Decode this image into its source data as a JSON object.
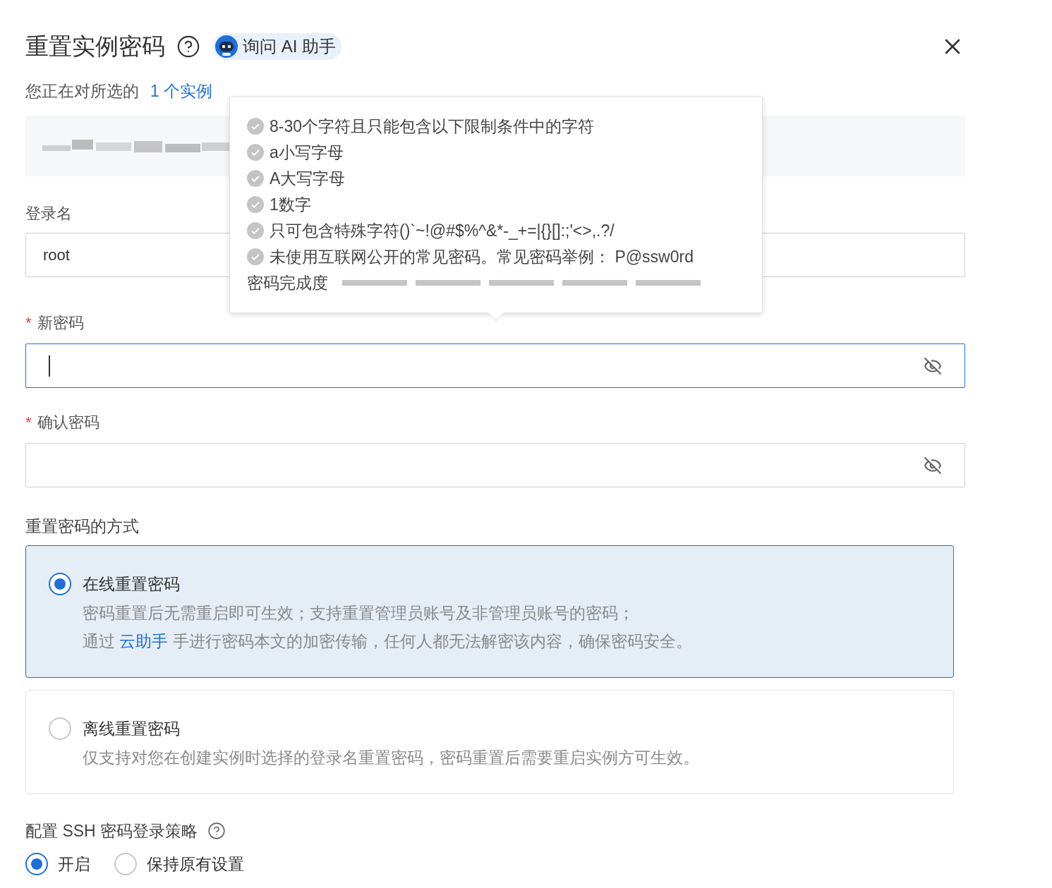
{
  "dialog": {
    "title": "重置实例密码",
    "ai_button": "询问 AI 助手"
  },
  "intro": {
    "text": "您正在对所选的",
    "link": "1 个实例"
  },
  "login_name": {
    "label": "登录名",
    "value": "root"
  },
  "new_password": {
    "label": "新密码",
    "required_mark": "*",
    "focused": true
  },
  "confirm_password": {
    "label": "确认密码",
    "required_mark": "*",
    "focused": false
  },
  "password_tooltip": {
    "rules": [
      {
        "text": "8-30个字符且只能包含以下限制条件中的字符",
        "met": false
      },
      {
        "text": "a小写字母",
        "met": false
      },
      {
        "text": "A大写字母",
        "met": false
      },
      {
        "text": "1数字",
        "met": false
      },
      {
        "text": "只可包含特殊字符()`~!@#$%^&*-_+=|{}[]:;'<>,.?/",
        "met": false
      },
      {
        "text": "未使用互联网公开的常见密码。常见密码举例： P@ssw0rd",
        "met": false
      }
    ],
    "strength": {
      "label": "密码完成度",
      "segments": [
        {
          "filled": false
        },
        {
          "filled": false
        },
        {
          "filled": false
        },
        {
          "filled": false
        },
        {
          "filled": false
        }
      ]
    }
  },
  "reset_method": {
    "label": "重置密码的方式",
    "options": [
      {
        "title": "在线重置密码",
        "selected": true,
        "lines": [
          [
            {
              "kind": "text",
              "text": "密码重置后无需重启即可生效；支持重置管理员账号及非管理员账号的密码；"
            }
          ],
          [
            {
              "kind": "text",
              "text": "通过 "
            },
            {
              "kind": "link",
              "text": "云助手"
            },
            {
              "kind": "text",
              "text": " 手进行密码本文的加密传输，任何人都无法解密该内容，确保密码安全。"
            }
          ]
        ]
      },
      {
        "title": "离线重置密码",
        "selected": false,
        "lines": [
          [
            {
              "kind": "text",
              "text": "仅支持对您在创建实例时选择的登录名重置密码，密码重置后需要重启实例方可生效。"
            }
          ]
        ]
      }
    ]
  },
  "ssh_policy": {
    "label": "配置 SSH 密码登录策略",
    "options": [
      {
        "label": "开启",
        "selected": true
      },
      {
        "label": "保持原有设置",
        "selected": false
      }
    ]
  }
}
